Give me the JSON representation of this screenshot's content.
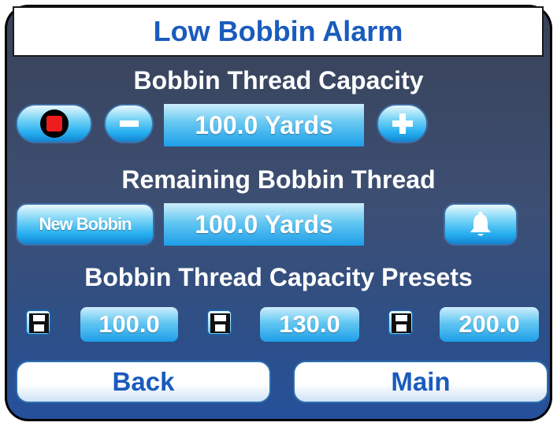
{
  "title": "Low Bobbin Alarm",
  "capacity": {
    "heading": "Bobbin Thread Capacity",
    "value": "100.0 Yards",
    "decrement_icon": "minus-icon",
    "increment_icon": "plus-icon",
    "record_icon": "stop-record-icon"
  },
  "remaining": {
    "heading": "Remaining Bobbin Thread",
    "new_bobbin_label": "New Bobbin",
    "value": "100.0 Yards",
    "alarm_icon": "bell-icon"
  },
  "presets": {
    "heading": "Bobbin Thread Capacity Presets",
    "items": [
      {
        "value": "100.0",
        "save_icon": "floppy-disk-icon"
      },
      {
        "value": "130.0",
        "save_icon": "floppy-disk-icon"
      },
      {
        "value": "200.0",
        "save_icon": "floppy-disk-icon"
      }
    ]
  },
  "nav": {
    "back_label": "Back",
    "main_label": "Main"
  },
  "colors": {
    "title_text": "#1a5bbd",
    "button_blue": "#26aef0",
    "record_red": "#ee1c1c"
  }
}
